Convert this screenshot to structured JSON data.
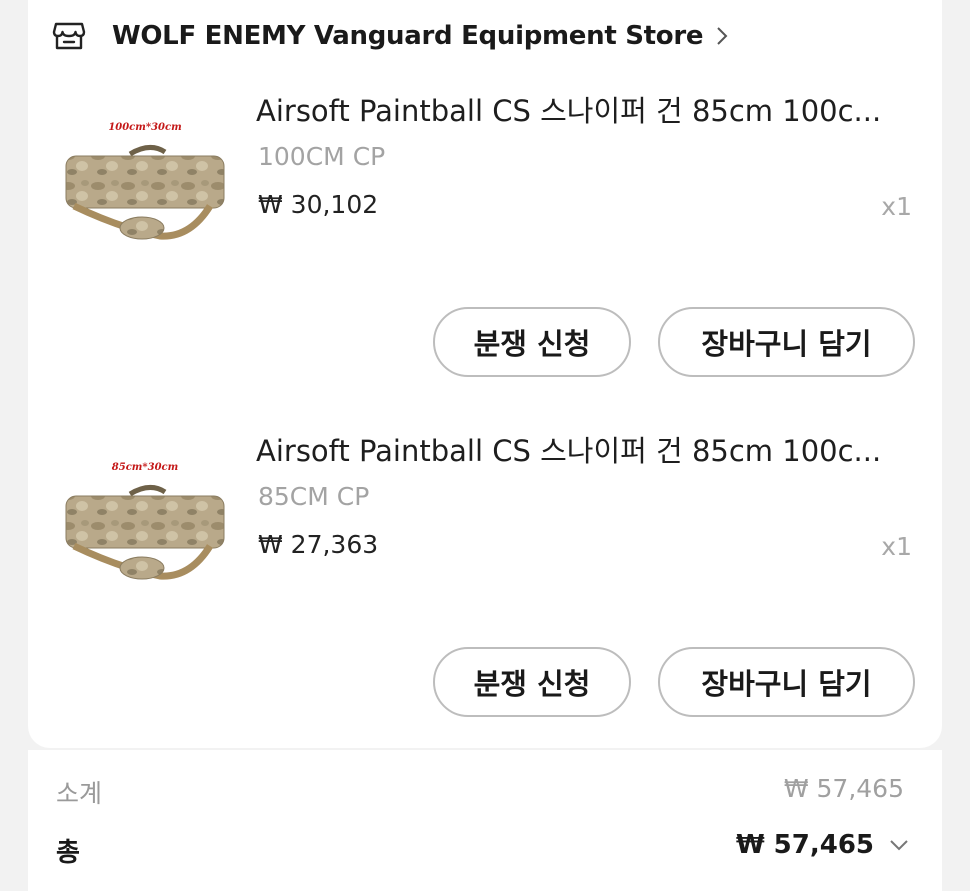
{
  "store": {
    "name": "WOLF ENEMY Vanguard Equipment Store",
    "icon": "store-icon"
  },
  "items": [
    {
      "title": "Airsoft Paintball CS 스나이퍼 건 85cm 100c...",
      "variant": "100CM CP",
      "price": "₩ 30,102",
      "quantity": "x1",
      "image_tag": "100cm*30cm",
      "dispute_label": "분쟁 신청",
      "cart_label": "장바구니 담기"
    },
    {
      "title": "Airsoft Paintball CS 스나이퍼 건 85cm 100c...",
      "variant": "85CM CP",
      "price": "₩ 27,363",
      "quantity": "x1",
      "image_tag": "85cm*30cm",
      "dispute_label": "분쟁 신청",
      "cart_label": "장바구니 담기"
    }
  ],
  "summary": {
    "subtotal_label": "소계",
    "subtotal_value": "₩ 57,465",
    "total_label": "총",
    "total_value": "₩ 57,465"
  },
  "colors": {
    "background": "#f2f2f2",
    "card": "#ffffff",
    "text_primary": "#1a1a1a",
    "text_muted": "#a3a3a3",
    "button_border": "#bdbdbd"
  }
}
